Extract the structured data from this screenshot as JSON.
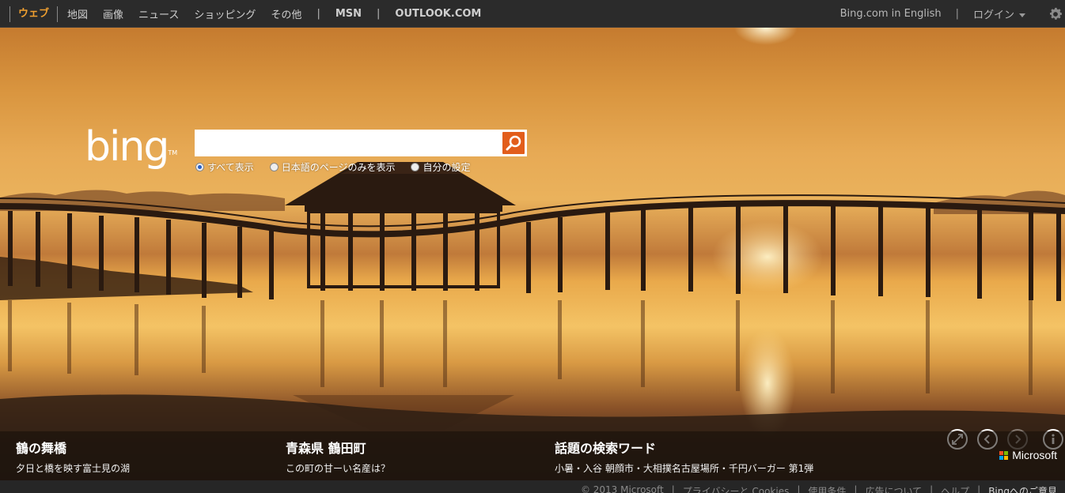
{
  "nav": {
    "active": "ウェブ",
    "items": [
      "地図",
      "画像",
      "ニュース",
      "ショッピング",
      "その他"
    ],
    "sep": "|",
    "links": [
      "MSN",
      "OUTLOOK.COM"
    ]
  },
  "account": {
    "english": "Bing.com in English",
    "sep": "|",
    "login": "ログイン"
  },
  "logo": {
    "text": "bing",
    "tm": "TM"
  },
  "search": {
    "value": "",
    "placeholder": ""
  },
  "options": [
    {
      "label": "すべて表示",
      "selected": true
    },
    {
      "label": "日本語のページのみを表示",
      "selected": false
    },
    {
      "label": "自分の設定",
      "selected": false
    }
  ],
  "captions": [
    {
      "title": "鶴の舞橋",
      "subtitle": "夕日と橋を映す富士見の湖"
    },
    {
      "title": "青森県 鶴田町",
      "subtitle": "この町の甘ーい名産は？"
    },
    {
      "title": "話題の検索ワード",
      "subtitle": "小暑・入谷 朝顔市・大相撲名古屋場所・千円バーガー 第1弾"
    }
  ],
  "brand": "Microsoft",
  "footer": {
    "copyright": "© 2013 Microsoft",
    "sep": "|",
    "privacy": "プライバシーと Cookies",
    "terms": "使用条件",
    "ads": "広告について",
    "help": "ヘルプ",
    "feedback": "Bingへのご意見"
  },
  "colors": {
    "accent": "#f0a030",
    "search_button": "#e25d1b",
    "topbar": "#2b2b2b"
  }
}
